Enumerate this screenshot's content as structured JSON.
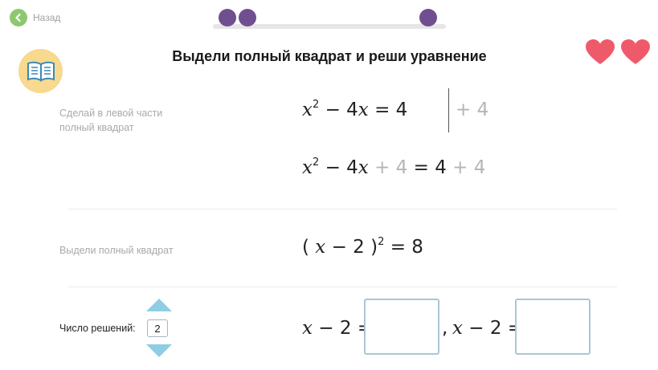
{
  "nav": {
    "back_label": "Назад"
  },
  "progress": {
    "filled_steps": 3
  },
  "task": {
    "title": "Выдели полный квадрат и реши уравнение"
  },
  "lives": {
    "hearts": 2
  },
  "step1": {
    "hint": [
      "Сделай в левой части",
      "полный квадрат"
    ],
    "eq1": {
      "var": "x",
      "exp": "2",
      "mid": " − 4",
      "var2": "x",
      "rhs": " = 4"
    },
    "side_op": "+ 4",
    "eq2": {
      "var": "x",
      "exp": "2",
      "mid": " − 4",
      "var2": "x",
      "add1": " + 4",
      "eqrhs": " = 4",
      "add2": " + 4"
    }
  },
  "step2": {
    "hint": "Выдели полный квадрат",
    "eq": {
      "open": "(",
      "var": "x",
      "mid": " − 2 ",
      "close": ")",
      "exp": "2",
      "rhs": " = 8"
    }
  },
  "step3": {
    "count_label": "Число решений:",
    "count_value": "2",
    "eq_left": {
      "var": "x",
      "rest": " − 2 ="
    },
    "separator": ",",
    "eq_right": {
      "var": "x",
      "rest": " − 2 ="
    }
  },
  "colors": {
    "accent_green": "#8dc86f",
    "progress_dot": "#6f4f8f",
    "heart": "#ef5a6a",
    "arrow": "#8ecde4"
  }
}
